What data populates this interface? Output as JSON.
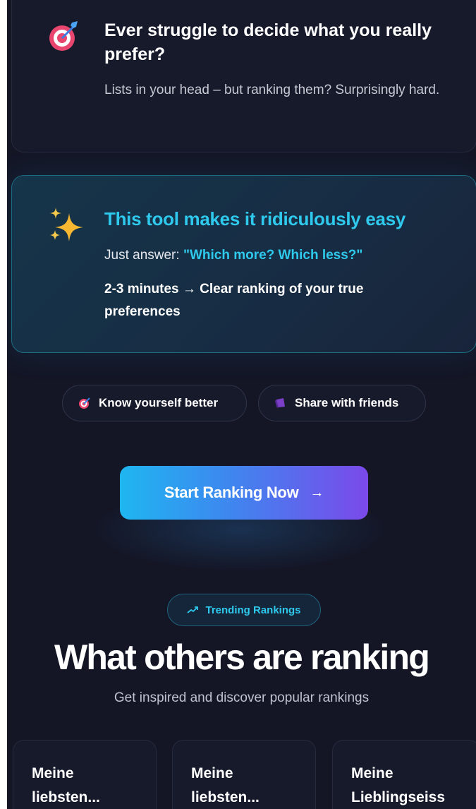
{
  "intro_card": {
    "title": "Ever struggle to decide what you really prefer?",
    "subtitle": "Lists in your head – but ranking them? Surprisingly hard."
  },
  "tool_card": {
    "title": "This tool makes it ridiculously easy",
    "answer_prefix": "Just answer: ",
    "answer_quote": "\"Which more? Which less?\"",
    "result_line": "2-3 minutes → Clear ranking of your true preferences"
  },
  "pills": [
    {
      "label": "Know yourself better",
      "icon": "target-icon"
    },
    {
      "label": "Share with friends",
      "icon": "megaphone-icon"
    }
  ],
  "cta": {
    "label": "Start Ranking Now",
    "arrow": "→"
  },
  "trending": {
    "badge": "Trending Rankings",
    "heading": "What others are ranking",
    "subheading": "Get inspired and discover popular rankings",
    "cards": [
      {
        "title": "Meine\nliebsten..."
      },
      {
        "title": "Meine\nliebsten..."
      },
      {
        "title": "Meine\nLieblingseiss"
      }
    ]
  },
  "colors": {
    "background": "#141626",
    "accent_cyan": "#2ec9ec",
    "cta_gradient_start": "#1fb6f0",
    "cta_gradient_end": "#7b49ea"
  }
}
